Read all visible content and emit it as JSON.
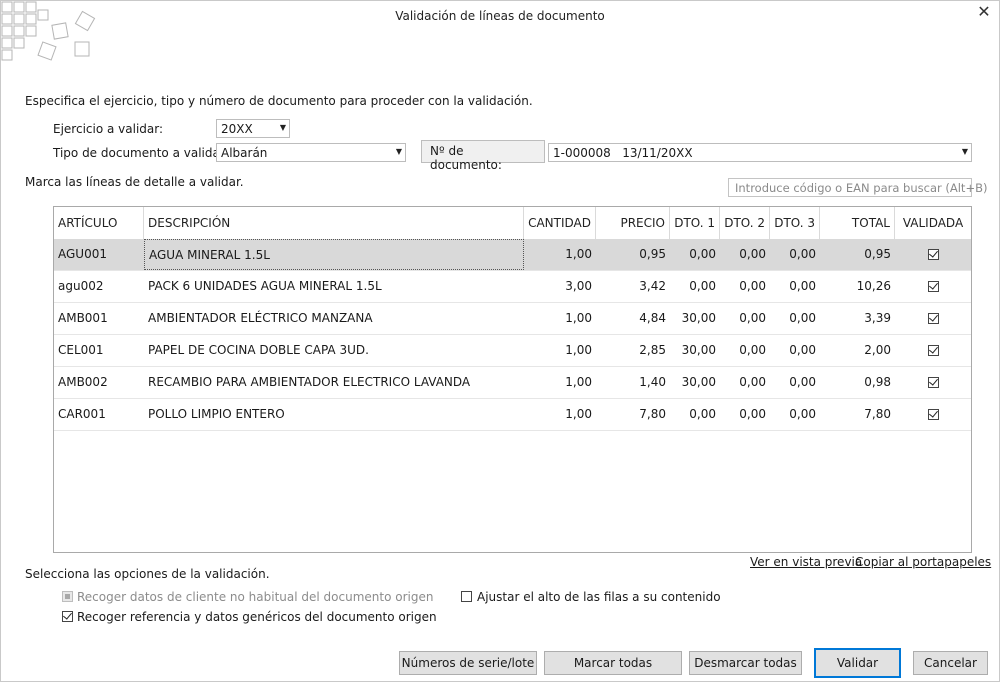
{
  "window": {
    "title": "Validación de líneas de documento",
    "close_icon": "close-icon"
  },
  "intro": "Especifica el ejercicio, tipo y número de documento para proceder con la validación.",
  "form": {
    "ejercicio_label": "Ejercicio a validar:",
    "ejercicio_value": "20XX",
    "tipo_label": "Tipo de documento a validar:",
    "tipo_value": "Albarán",
    "numero_label": "Nº de documento:",
    "numero_value": "1-000008   13/11/20XX"
  },
  "lines_prompt": "Marca las líneas de detalle a validar.",
  "search": {
    "placeholder": "Introduce código o EAN para buscar (Alt+B)"
  },
  "table": {
    "columns": [
      "ARTÍCULO",
      "DESCRIPCIÓN",
      "CANTIDAD",
      "PRECIO",
      "DTO. 1",
      "DTO. 2",
      "DTO. 3",
      "TOTAL",
      "VALIDADA"
    ],
    "rows": [
      {
        "articulo": "AGU001",
        "descripcion": "AGUA MINERAL 1.5L",
        "cantidad": "1,00",
        "precio": "0,95",
        "dto1": "0,00",
        "dto2": "0,00",
        "dto3": "0,00",
        "total": "0,95",
        "validada": true
      },
      {
        "articulo": "agu002",
        "descripcion": "PACK 6 UNIDADES AGUA MINERAL 1.5L",
        "cantidad": "3,00",
        "precio": "3,42",
        "dto1": "0,00",
        "dto2": "0,00",
        "dto3": "0,00",
        "total": "10,26",
        "validada": true
      },
      {
        "articulo": "AMB001",
        "descripcion": "AMBIENTADOR ELÉCTRICO MANZANA",
        "cantidad": "1,00",
        "precio": "4,84",
        "dto1": "30,00",
        "dto2": "0,00",
        "dto3": "0,00",
        "total": "3,39",
        "validada": true
      },
      {
        "articulo": "CEL001",
        "descripcion": "PAPEL DE COCINA DOBLE CAPA 3UD.",
        "cantidad": "1,00",
        "precio": "2,85",
        "dto1": "30,00",
        "dto2": "0,00",
        "dto3": "0,00",
        "total": "2,00",
        "validada": true
      },
      {
        "articulo": "AMB002",
        "descripcion": "RECAMBIO PARA AMBIENTADOR ELECTRICO LAVANDA",
        "cantidad": "1,00",
        "precio": "1,40",
        "dto1": "30,00",
        "dto2": "0,00",
        "dto3": "0,00",
        "total": "0,98",
        "validada": true
      },
      {
        "articulo": "CAR001",
        "descripcion": "POLLO LIMPIO ENTERO",
        "cantidad": "1,00",
        "precio": "7,80",
        "dto1": "0,00",
        "dto2": "0,00",
        "dto3": "0,00",
        "total": "7,80",
        "validada": true
      }
    ]
  },
  "links": {
    "preview": "Ver en vista previa",
    "clipboard": "Copiar al portapapeles"
  },
  "options": {
    "heading": "Selecciona las opciones de la validación.",
    "recoger_cliente": {
      "label": "Recoger datos de cliente no habitual del documento origen",
      "checked": true,
      "disabled": true
    },
    "ajustar_alto": {
      "label": "Ajustar el alto de las filas a su contenido",
      "checked": false
    },
    "recoger_referencia": {
      "label": "Recoger referencia y datos genéricos del documento origen",
      "checked": true
    }
  },
  "buttons": {
    "series": "Números de serie/lote",
    "marcar": "Marcar todas",
    "desmarcar": "Desmarcar todas",
    "validar": "Validar",
    "cancelar": "Cancelar"
  },
  "colors": {
    "accent": "#0078d7",
    "selected_row": "#d9d9d9",
    "button_bg": "#e1e1e1"
  }
}
